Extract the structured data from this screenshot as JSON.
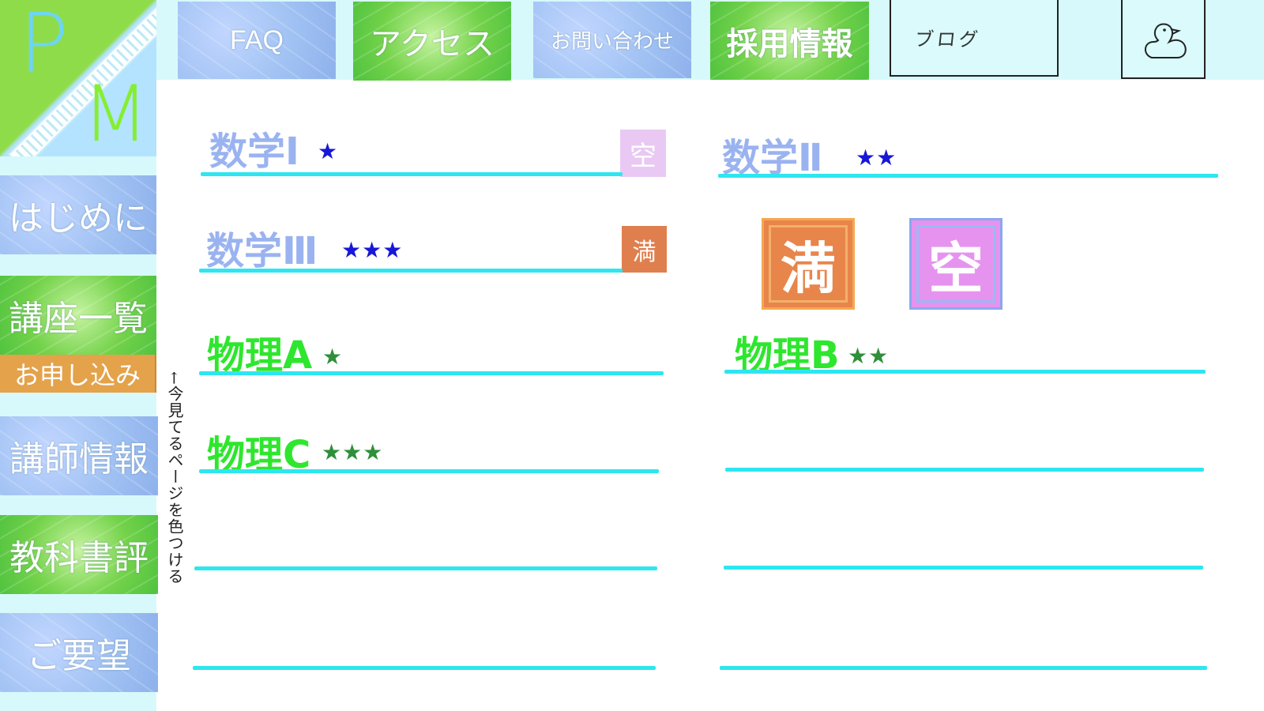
{
  "logo": {
    "letter_top": "P",
    "letter_bottom": "M"
  },
  "header": {
    "nav": [
      {
        "label": "FAQ"
      },
      {
        "label": "アクセス"
      },
      {
        "label": "お問い合わせ"
      },
      {
        "label": "採用情報"
      }
    ],
    "blog_label": "ブログ"
  },
  "sidebar": {
    "items": [
      {
        "label": "はじめに"
      },
      {
        "label": "講座一覧"
      },
      {
        "label": "お申し込み"
      },
      {
        "label": "講師情報"
      },
      {
        "label": "教科書評"
      },
      {
        "label": "ご要望"
      }
    ],
    "note": "←今見てるページを色つける"
  },
  "courses": [
    {
      "name": "数学Ⅰ",
      "stars": "★",
      "badge": "空"
    },
    {
      "name": "数学Ⅱ",
      "stars": "★★"
    },
    {
      "name": "数学Ⅲ",
      "stars": "★★★",
      "badge": "満"
    },
    {
      "name": "物理A",
      "stars": "★"
    },
    {
      "name": "物理B",
      "stars": "★★"
    },
    {
      "name": "物理C",
      "stars": "★★★"
    }
  ],
  "legend": {
    "full": "満",
    "empty": "空"
  },
  "colors": {
    "math_title": "#9ab3f0",
    "physics_title": "#2ee62e",
    "underline": "#2de6f0",
    "apply_bar": "#e4a24a",
    "badge_full": "#e8854b",
    "badge_empty": "#e693ef"
  }
}
